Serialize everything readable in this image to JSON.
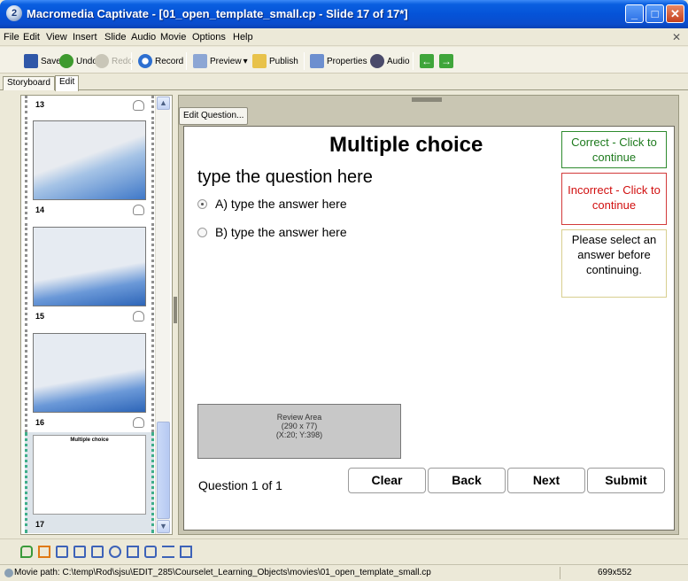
{
  "window": {
    "title": "Macromedia Captivate - [01_open_template_small.cp - Slide 17 of 17*]",
    "controls": [
      "_",
      "□",
      "X"
    ]
  },
  "menu": [
    "File",
    "Edit",
    "View",
    "Insert",
    "Slide",
    "Audio",
    "Movie",
    "Options",
    "Help"
  ],
  "toolbar": {
    "save": "Save",
    "undo": "Undo",
    "redo": "Redo",
    "record": "Record",
    "preview": "Preview",
    "publish": "Publish",
    "properties": "Properties",
    "audio": "Audio"
  },
  "tabs": [
    "Storyboard",
    "Edit"
  ],
  "filmstrip": {
    "slides": [
      {
        "number": "13"
      },
      {
        "number": "14"
      },
      {
        "number": "15"
      },
      {
        "number": "16"
      },
      {
        "number": "17",
        "thumb_title": "Multiple choice"
      }
    ]
  },
  "editor": {
    "edit_question_button": "Edit Question...",
    "slide_title": "Multiple choice",
    "question_text": "type the question here",
    "answers": [
      {
        "label": "A) type the answer here",
        "selected": true
      },
      {
        "label": "B) type the answer here",
        "selected": false
      }
    ],
    "feedback": {
      "correct": "Correct - Click to continue",
      "incorrect": "Incorrect - Click to continue",
      "incomplete": "Please select an answer before continuing."
    },
    "review_area": {
      "line1": "Review Area",
      "line2": "(290 x 77)",
      "line3": "(X:20; Y:398)"
    },
    "counter": "Question 1 of 1",
    "buttons": {
      "clear": "Clear",
      "back": "Back",
      "next": "Next",
      "submit": "Submit"
    }
  },
  "statusbar": {
    "path": "Movie path: C:\\temp\\Rod\\sjsu\\EDIT_285\\Courselet_Learning_Objects\\movies\\01_open_template_small.cp",
    "size": "699x552"
  },
  "colors": {
    "titlebar": "#0553d8",
    "correct": "#1d7a1d",
    "incorrect": "#d10f0f"
  }
}
